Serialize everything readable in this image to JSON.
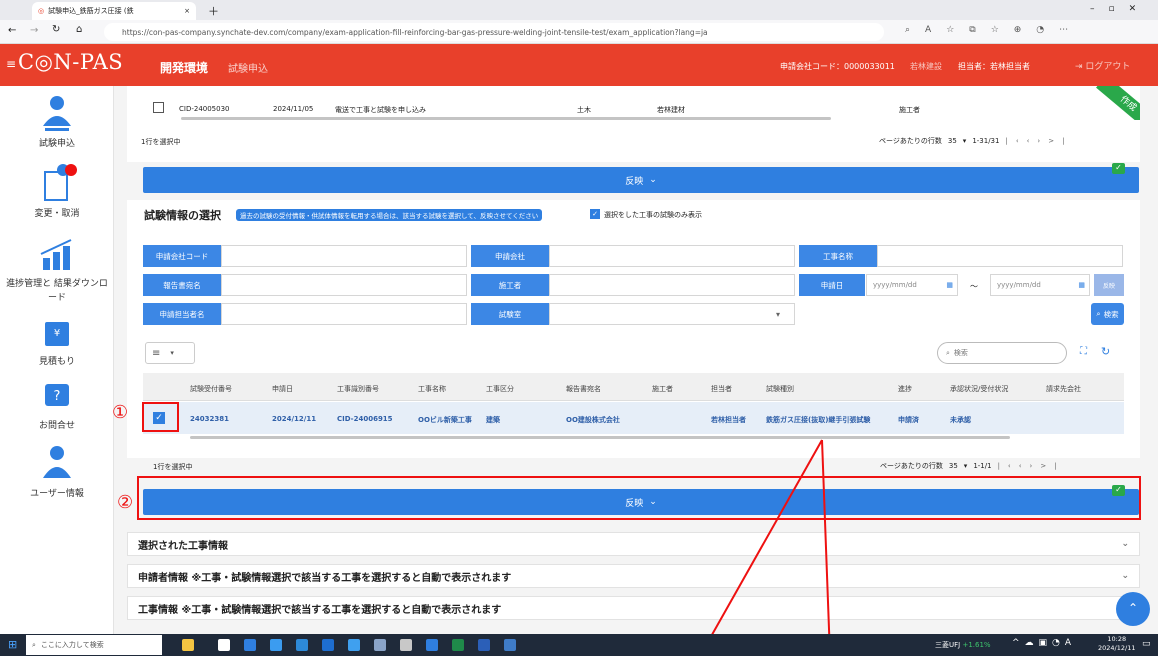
{
  "browser": {
    "tab_title": "試験申込_鉄筋ガス圧接 (鉄",
    "url": "https://con-pas-company.synchate-dev.com/company/exam-application-fill-reinforcing-bar-gas-pressure-welding-joint-tensile-test/exam_application?lang=ja"
  },
  "header": {
    "logo": "C◎N-PAS",
    "env": "開発環境",
    "section": "試験申込",
    "company_code": "申請会社コード：0000033011",
    "company_link": "若林建設",
    "person": "担当者：若林担当者",
    "logout": "ログアウト"
  },
  "sidebar": {
    "items": [
      {
        "label": "試験申込"
      },
      {
        "label": "変更・取消"
      },
      {
        "label": "進捗管理と 結果ダウンロード"
      },
      {
        "label": "見積もり"
      },
      {
        "label": "お問合せ"
      },
      {
        "label": "ユーザー情報"
      }
    ]
  },
  "top_table": {
    "row": {
      "id": "CID-24005030",
      "date": "2024/11/05",
      "name": "電送で工事と試験を申し込み",
      "type": "土木",
      "company": "若林建材",
      "role": "施工者"
    },
    "selected": "1行を選択中",
    "pager_label": "ページあたりの行数",
    "pager_size": "35",
    "pager_range": "1-31/31",
    "ribbon": "作成"
  },
  "reflect_label": "反映",
  "selection": {
    "title": "試験情報の選択",
    "note": "過去の試験の受付情報・供試体情報を転用する場合は、該当する試験を選択して、反映させてください",
    "checkbox_label": "選択をした工事の試験のみ表示"
  },
  "filters": {
    "company_code": "申請会社コード",
    "company": "申請会社",
    "project": "工事名称",
    "report": "報告書宛名",
    "builder": "施工者",
    "apply_date": "申請日",
    "date_placeholder": "yyyy/mm/dd",
    "tilde": "～",
    "apply_btn": "反映",
    "person": "申請担当者名",
    "lab": "試験室",
    "search_btn": "検索"
  },
  "search_placeholder": "検索",
  "columns": [
    "試験受付番号",
    "申請日",
    "工事識別番号",
    "工事名称",
    "工事区分",
    "報告書宛名",
    "施工者",
    "担当者",
    "試験種別",
    "進捗",
    "承認状況/受付状況",
    "請求先会社"
  ],
  "result_row": [
    "24032381",
    "2024/12/11",
    "CID-24006915",
    "OOビル新築工事",
    "建築",
    "OO建設株式会社",
    "",
    "若林担当者",
    "鉄筋ガス圧接(抜取)継手引張試験",
    "申請済",
    "未承認",
    ""
  ],
  "bottom_pager": {
    "selected": "1行を選択中",
    "label": "ページあたりの行数",
    "size": "35",
    "range": "1-1/1"
  },
  "accordions": [
    "選択された工事情報",
    "申請者情報 ※工事・試験情報選択で該当する工事を選択すると自動で表示されます",
    "工事情報 ※工事・試験情報選択で該当する工事を選択すると自動で表示されます"
  ],
  "annotations": {
    "one": "①",
    "two": "②"
  },
  "taskbar": {
    "search": "ここに入力して検索",
    "stock": "三菱UFJ",
    "stock_change": "+1.61%",
    "time": "10:28",
    "date": "2024/12/11"
  },
  "colors": {
    "brand": "#e8402b",
    "primary": "#2f7fe0",
    "annotation": "#e11111"
  }
}
